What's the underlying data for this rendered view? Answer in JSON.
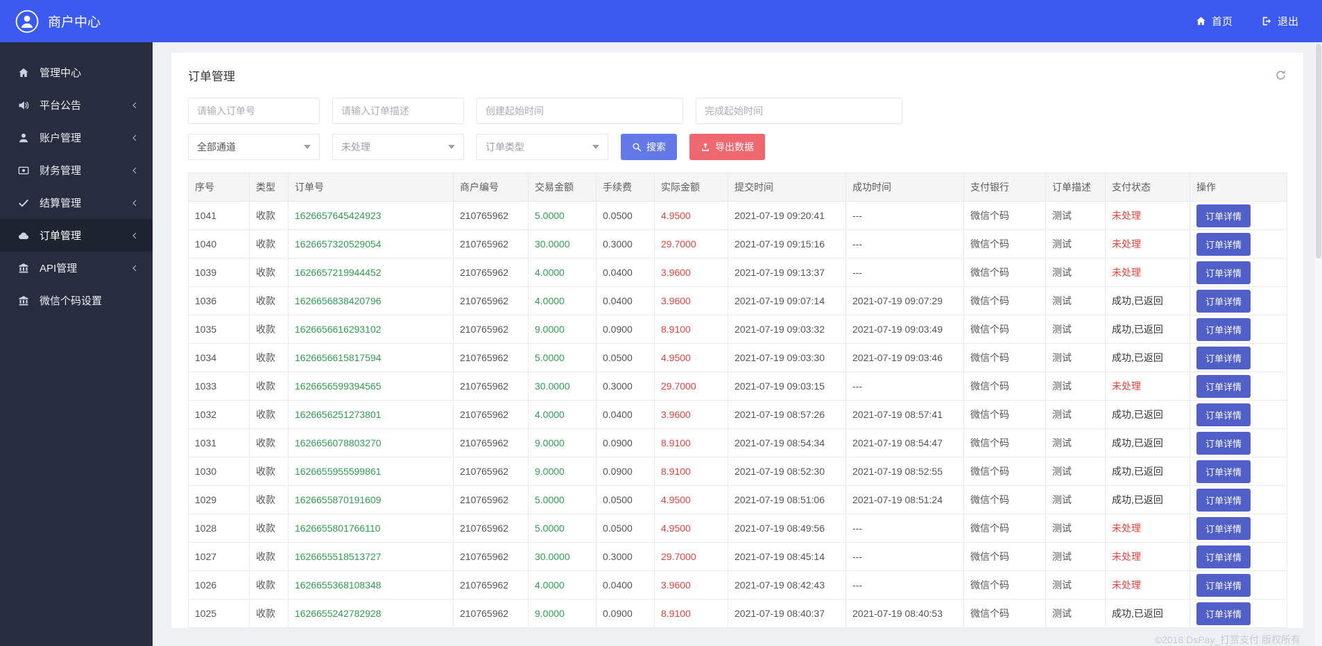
{
  "topbar": {
    "brand": "商户中心",
    "home": "首页",
    "logout": "退出",
    "logo_icon": "user-avatar-logo-icon",
    "home_icon": "home-icon",
    "logout_icon": "logout-icon"
  },
  "sidebar": {
    "items": [
      {
        "label": "管理中心",
        "icon": "dashboard-home-icon",
        "expandable": false,
        "active": false
      },
      {
        "label": "平台公告",
        "icon": "announcement-speaker-icon",
        "expandable": true,
        "active": false
      },
      {
        "label": "账户管理",
        "icon": "account-user-icon",
        "expandable": true,
        "active": false
      },
      {
        "label": "财务管理",
        "icon": "finance-card-icon",
        "expandable": true,
        "active": false
      },
      {
        "label": "结算管理",
        "icon": "settlement-check-icon",
        "expandable": true,
        "active": false
      },
      {
        "label": "订单管理",
        "icon": "order-cloud-icon",
        "expandable": true,
        "active": true
      },
      {
        "label": "API管理",
        "icon": "api-bank-icon",
        "expandable": true,
        "active": false
      },
      {
        "label": "微信个码设置",
        "icon": "wechat-bank-icon",
        "expandable": false,
        "active": false
      }
    ]
  },
  "page": {
    "title": "订单管理",
    "refresh_icon": "refresh-icon",
    "filters": {
      "order_no_placeholder": "请输入订单号",
      "order_desc_placeholder": "请输入订单描述",
      "create_time_placeholder": "创建起始时间",
      "finish_time_placeholder": "完成起始时间",
      "channel_select_value": "全部通道",
      "status_select_value": "未处理",
      "type_select_value": "订单类型",
      "search_button": "搜索",
      "search_icon": "search-icon",
      "export_button": "导出数据",
      "export_icon": "export-icon"
    },
    "table": {
      "headers": [
        "序号",
        "类型",
        "订单号",
        "商户编号",
        "交易金额",
        "手续费",
        "实际金额",
        "提交时间",
        "成功时间",
        "支付银行",
        "订单描述",
        "支付状态",
        "操作"
      ],
      "action_label": "订单详情",
      "rows": [
        {
          "id": "1041",
          "type": "收款",
          "order_no": "1626657645424923",
          "merchant": "210765962",
          "amount": "5.0000",
          "fee": "0.0500",
          "actual": "4.9500",
          "submit": "2021-07-19 09:20:41",
          "success": "---",
          "bank": "微信个码",
          "desc": "测试",
          "status": "未处理",
          "status_type": "pending"
        },
        {
          "id": "1040",
          "type": "收款",
          "order_no": "1626657320529054",
          "merchant": "210765962",
          "amount": "30.0000",
          "fee": "0.3000",
          "actual": "29.7000",
          "submit": "2021-07-19 09:15:16",
          "success": "---",
          "bank": "微信个码",
          "desc": "测试",
          "status": "未处理",
          "status_type": "pending"
        },
        {
          "id": "1039",
          "type": "收款",
          "order_no": "1626657219944452",
          "merchant": "210765962",
          "amount": "4.0000",
          "fee": "0.0400",
          "actual": "3.9600",
          "submit": "2021-07-19 09:13:37",
          "success": "---",
          "bank": "微信个码",
          "desc": "测试",
          "status": "未处理",
          "status_type": "pending"
        },
        {
          "id": "1036",
          "type": "收款",
          "order_no": "1626656838420796",
          "merchant": "210765962",
          "amount": "4.0000",
          "fee": "0.0400",
          "actual": "3.9600",
          "submit": "2021-07-19 09:07:14",
          "success": "2021-07-19 09:07:29",
          "bank": "微信个码",
          "desc": "测试",
          "status": "成功,已返回",
          "status_type": "success"
        },
        {
          "id": "1035",
          "type": "收款",
          "order_no": "1626656616293102",
          "merchant": "210765962",
          "amount": "9.0000",
          "fee": "0.0900",
          "actual": "8.9100",
          "submit": "2021-07-19 09:03:32",
          "success": "2021-07-19 09:03:49",
          "bank": "微信个码",
          "desc": "测试",
          "status": "成功,已返回",
          "status_type": "success"
        },
        {
          "id": "1034",
          "type": "收款",
          "order_no": "1626656615817594",
          "merchant": "210765962",
          "amount": "5.0000",
          "fee": "0.0500",
          "actual": "4.9500",
          "submit": "2021-07-19 09:03:30",
          "success": "2021-07-19 09:03:46",
          "bank": "微信个码",
          "desc": "测试",
          "status": "成功,已返回",
          "status_type": "success"
        },
        {
          "id": "1033",
          "type": "收款",
          "order_no": "1626656599394565",
          "merchant": "210765962",
          "amount": "30.0000",
          "fee": "0.3000",
          "actual": "29.7000",
          "submit": "2021-07-19 09:03:15",
          "success": "---",
          "bank": "微信个码",
          "desc": "测试",
          "status": "未处理",
          "status_type": "pending"
        },
        {
          "id": "1032",
          "type": "收款",
          "order_no": "1626656251273801",
          "merchant": "210765962",
          "amount": "4.0000",
          "fee": "0.0400",
          "actual": "3.9600",
          "submit": "2021-07-19 08:57:26",
          "success": "2021-07-19 08:57:41",
          "bank": "微信个码",
          "desc": "测试",
          "status": "成功,已返回",
          "status_type": "success"
        },
        {
          "id": "1031",
          "type": "收款",
          "order_no": "1626656078803270",
          "merchant": "210765962",
          "amount": "9.0000",
          "fee": "0.0900",
          "actual": "8.9100",
          "submit": "2021-07-19 08:54:34",
          "success": "2021-07-19 08:54:47",
          "bank": "微信个码",
          "desc": "测试",
          "status": "成功,已返回",
          "status_type": "success"
        },
        {
          "id": "1030",
          "type": "收款",
          "order_no": "1626655955599861",
          "merchant": "210765962",
          "amount": "9.0000",
          "fee": "0.0900",
          "actual": "8.9100",
          "submit": "2021-07-19 08:52:30",
          "success": "2021-07-19 08:52:55",
          "bank": "微信个码",
          "desc": "测试",
          "status": "成功,已返回",
          "status_type": "success"
        },
        {
          "id": "1029",
          "type": "收款",
          "order_no": "1626655870191609",
          "merchant": "210765962",
          "amount": "5.0000",
          "fee": "0.0500",
          "actual": "4.9500",
          "submit": "2021-07-19 08:51:06",
          "success": "2021-07-19 08:51:24",
          "bank": "微信个码",
          "desc": "测试",
          "status": "成功,已返回",
          "status_type": "success"
        },
        {
          "id": "1028",
          "type": "收款",
          "order_no": "1626655801766110",
          "merchant": "210765962",
          "amount": "5.0000",
          "fee": "0.0500",
          "actual": "4.9500",
          "submit": "2021-07-19 08:49:56",
          "success": "---",
          "bank": "微信个码",
          "desc": "测试",
          "status": "未处理",
          "status_type": "pending"
        },
        {
          "id": "1027",
          "type": "收款",
          "order_no": "1626655518513727",
          "merchant": "210765962",
          "amount": "30.0000",
          "fee": "0.3000",
          "actual": "29.7000",
          "submit": "2021-07-19 08:45:14",
          "success": "---",
          "bank": "微信个码",
          "desc": "测试",
          "status": "未处理",
          "status_type": "pending"
        },
        {
          "id": "1026",
          "type": "收款",
          "order_no": "1626655368108348",
          "merchant": "210765962",
          "amount": "4.0000",
          "fee": "0.0400",
          "actual": "3.9600",
          "submit": "2021-07-19 08:42:43",
          "success": "---",
          "bank": "微信个码",
          "desc": "测试",
          "status": "未处理",
          "status_type": "pending"
        },
        {
          "id": "1025",
          "type": "收款",
          "order_no": "1626655242782928",
          "merchant": "210765962",
          "amount": "9.0000",
          "fee": "0.0900",
          "actual": "8.9100",
          "submit": "2021-07-19 08:40:37",
          "success": "2021-07-19 08:40:53",
          "bank": "微信个码",
          "desc": "测试",
          "status": "成功,已返回",
          "status_type": "success"
        }
      ]
    }
  },
  "footer": "©2018 DsPay_打赏支付 版权所有",
  "colors": {
    "topbar_bg": "#3c5af0",
    "sidebar_bg": "#272c3e",
    "sidebar_active_bg": "#1e2330",
    "search_button": "#6379e8",
    "export_button": "#f0686f",
    "detail_button": "#5160c9",
    "link_green": "#2f9e4f",
    "danger_red": "#e8413c"
  }
}
